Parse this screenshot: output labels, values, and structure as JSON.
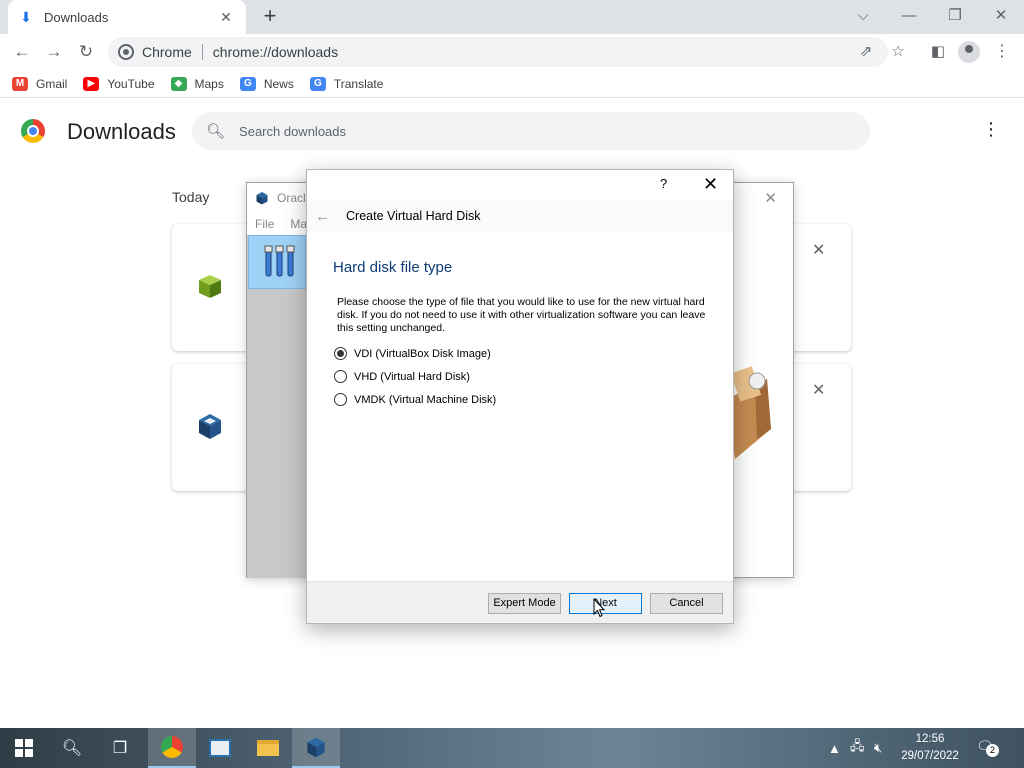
{
  "browser": {
    "tab_title": "Downloads",
    "site_name": "Chrome",
    "url": "chrome://downloads",
    "bookmarks": [
      {
        "label": "Gmail",
        "color": "#ea4335"
      },
      {
        "label": "YouTube",
        "color": "#ff0000"
      },
      {
        "label": "Maps",
        "color": "#34a853"
      },
      {
        "label": "News",
        "color": "#4285f4"
      },
      {
        "label": "Translate",
        "color": "#4285f4"
      }
    ]
  },
  "downloads_page": {
    "title": "Downloads",
    "search_placeholder": "Search downloads",
    "section_label": "Today"
  },
  "vbox_manager": {
    "title": "Oracle",
    "menu": [
      "File",
      "Ma"
    ]
  },
  "wizard": {
    "header_title": "Create Virtual Hard Disk",
    "help_label": "?",
    "page_title": "Hard disk file type",
    "description": "Please choose the type of file that you would like to use for the new virtual hard disk. If you do not need to use it with other virtualization software you can leave this setting unchanged.",
    "options": [
      {
        "label": "VDI (VirtualBox Disk Image)",
        "checked": true
      },
      {
        "label": "VHD (Virtual Hard Disk)",
        "checked": false
      },
      {
        "label": "VMDK (Virtual Machine Disk)",
        "checked": false
      }
    ],
    "buttons": {
      "expert": "Expert Mode",
      "next": "Next",
      "cancel": "Cancel"
    }
  },
  "taskbar": {
    "time": "12:56",
    "date": "29/07/2022",
    "notification_count": "2"
  }
}
